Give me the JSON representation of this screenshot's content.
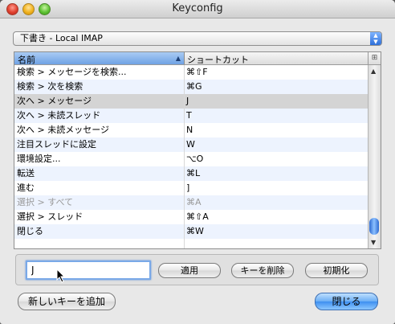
{
  "window": {
    "title": "Keyconfig"
  },
  "account_popup": {
    "selected": "下書き - Local IMAP"
  },
  "table": {
    "columns": [
      "名前",
      "ショートカット"
    ],
    "rows": [
      {
        "name": "検索 > メッセージを検索...",
        "shortcut": "⌘⇧F",
        "state": "normal"
      },
      {
        "name": "検索 > 次を検索",
        "shortcut": "⌘G",
        "state": "normal"
      },
      {
        "name": "次へ > メッセージ",
        "shortcut": "J",
        "state": "selected"
      },
      {
        "name": "次へ > 未読スレッド",
        "shortcut": "T",
        "state": "normal"
      },
      {
        "name": "次へ > 未読メッセージ",
        "shortcut": "N",
        "state": "normal"
      },
      {
        "name": "注目スレッドに設定",
        "shortcut": "W",
        "state": "normal"
      },
      {
        "name": "環境設定...",
        "shortcut": "⌥O",
        "state": "normal"
      },
      {
        "name": "転送",
        "shortcut": "⌘L",
        "state": "normal"
      },
      {
        "name": "進む",
        "shortcut": "]",
        "state": "normal"
      },
      {
        "name": "選択 > すべて",
        "shortcut": "⌘A",
        "state": "disabled"
      },
      {
        "name": "選択 > スレッド",
        "shortcut": "⌘⇧A",
        "state": "normal"
      },
      {
        "name": "閉じる",
        "shortcut": "⌘W",
        "state": "normal"
      }
    ]
  },
  "editor": {
    "key_value": "J",
    "apply_label": "適用",
    "delete_label": "キーを削除",
    "reset_label": "初期化"
  },
  "footer": {
    "add_label": "新しいキーを追加",
    "close_label": "閉じる"
  }
}
